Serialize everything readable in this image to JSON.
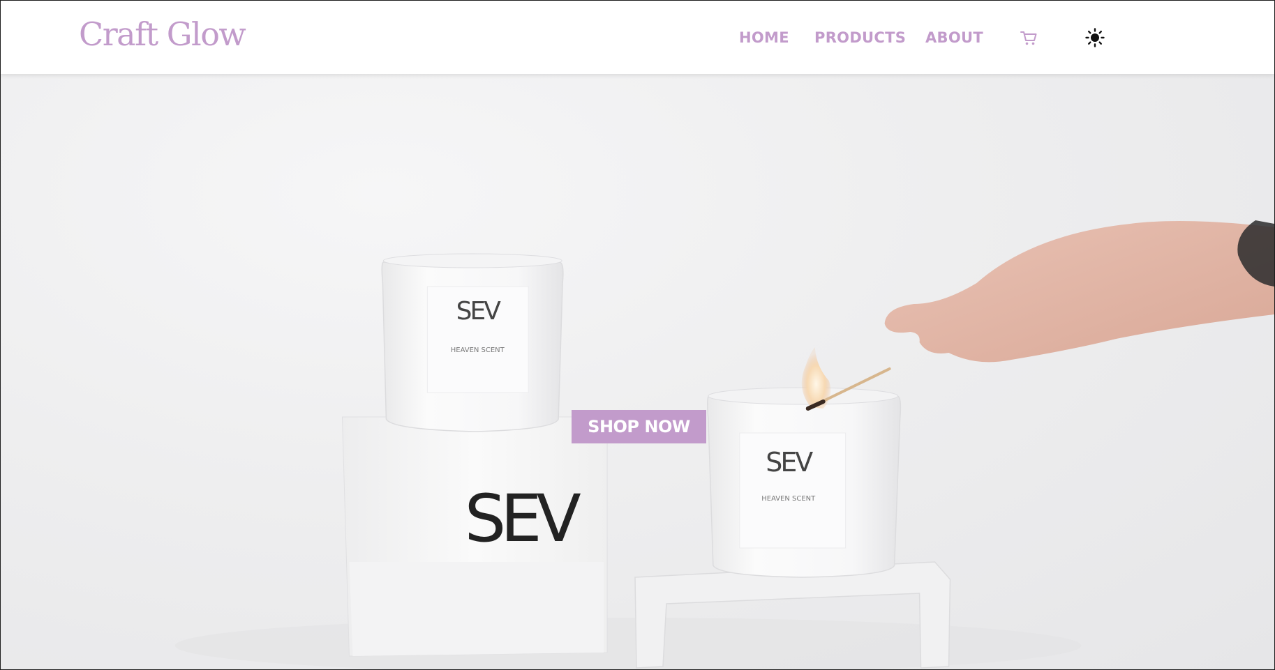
{
  "brand": {
    "logo_text": "Craft Glow",
    "accent_color": "#c29bcb"
  },
  "nav": {
    "items": [
      {
        "label": "HOME"
      },
      {
        "label": "PRODUCTS"
      },
      {
        "label": "ABOUT"
      }
    ],
    "cart_icon": "shopping-cart-icon",
    "theme_icon": "sun-icon"
  },
  "hero": {
    "cta_label": "SHOP NOW",
    "image_description_icon": "candle-hero-image",
    "product_label": {
      "brand": "SEV",
      "scent": "HEAVEN SCENT"
    }
  }
}
